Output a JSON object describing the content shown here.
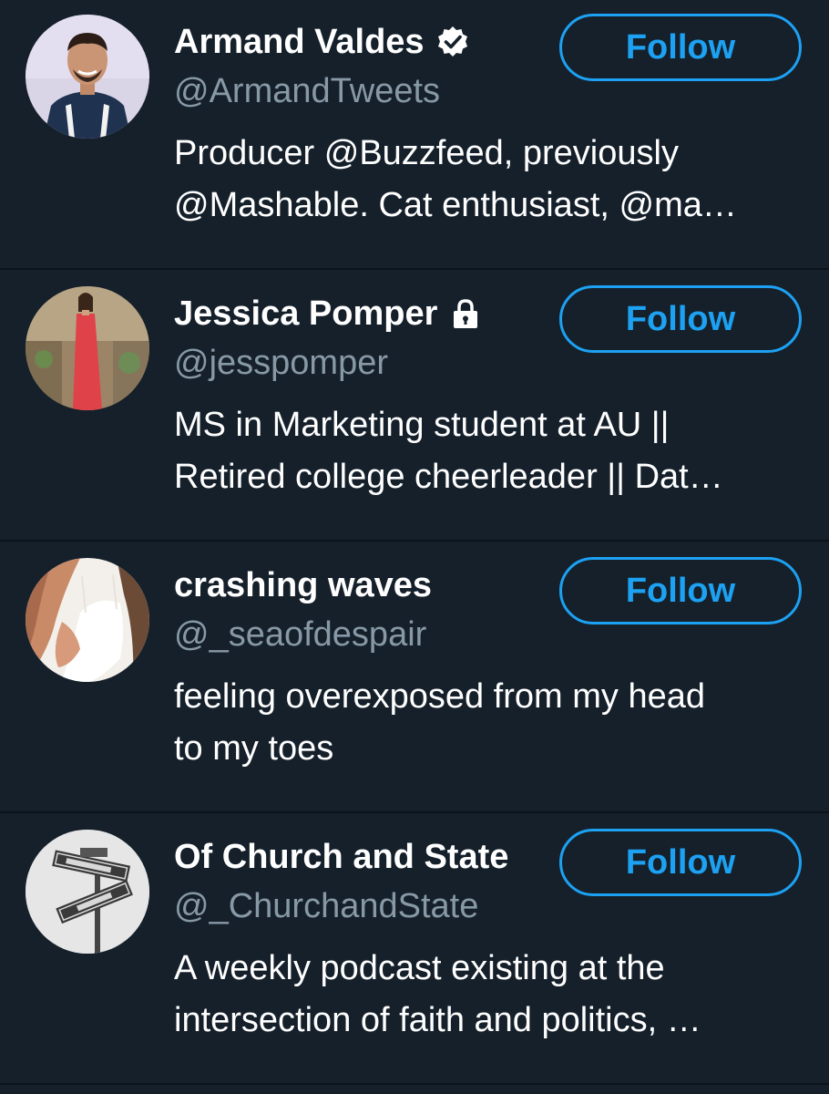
{
  "accent_color": "#1da1f2",
  "background_color": "#15202b",
  "secondary_text_color": "#8899a6",
  "accounts": [
    {
      "display_name": "Armand Valdes",
      "badge_icon": "verified-badge-icon",
      "handle": "@ArmandTweets",
      "bio_lines": [
        "Producer @Buzzfeed, previously",
        "@Mashable. Cat enthusiast, @ma…"
      ],
      "follow_label": "Follow"
    },
    {
      "display_name": "Jessica Pomper",
      "badge_icon": "lock-icon",
      "handle": "@jesspomper",
      "bio_lines": [
        "MS in Marketing student at AU ||",
        "Retired college cheerleader || Dat…"
      ],
      "follow_label": "Follow"
    },
    {
      "display_name": "crashing waves",
      "handle": "@_seaofdespair",
      "bio_lines": [
        "feeling overexposed from my head",
        "to my toes"
      ],
      "follow_label": "Follow"
    },
    {
      "display_name": "Of Church and State",
      "handle": "@_ChurchandState",
      "bio_lines": [
        "A weekly podcast existing at the",
        "intersection of faith and politics, …"
      ],
      "follow_label": "Follow"
    }
  ]
}
